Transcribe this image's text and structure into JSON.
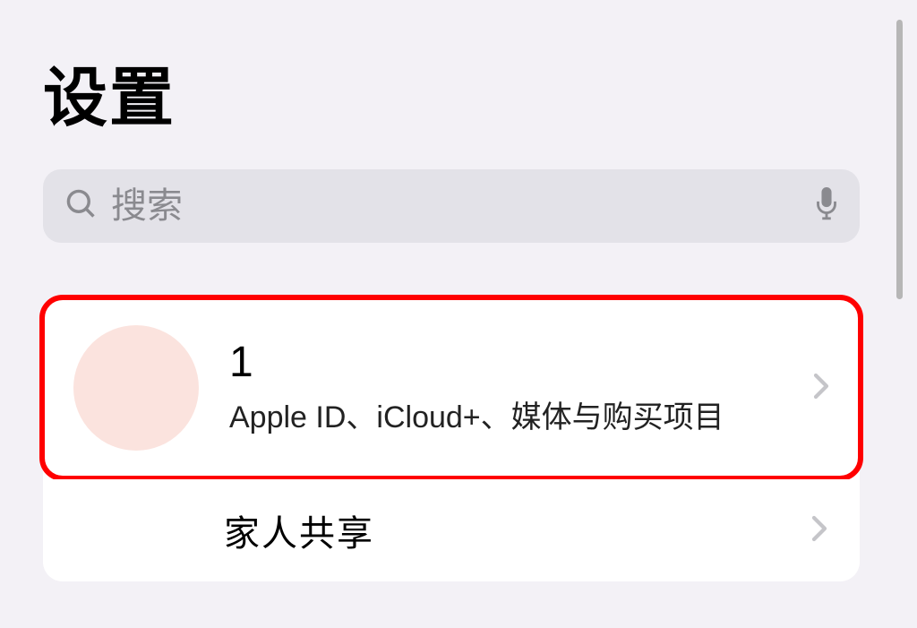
{
  "header": {
    "title": "设置"
  },
  "search": {
    "placeholder": "搜索"
  },
  "account": {
    "name": "1",
    "subtitle": "Apple ID、iCloud+、媒体与购买项目"
  },
  "family": {
    "label": "家人共享"
  }
}
